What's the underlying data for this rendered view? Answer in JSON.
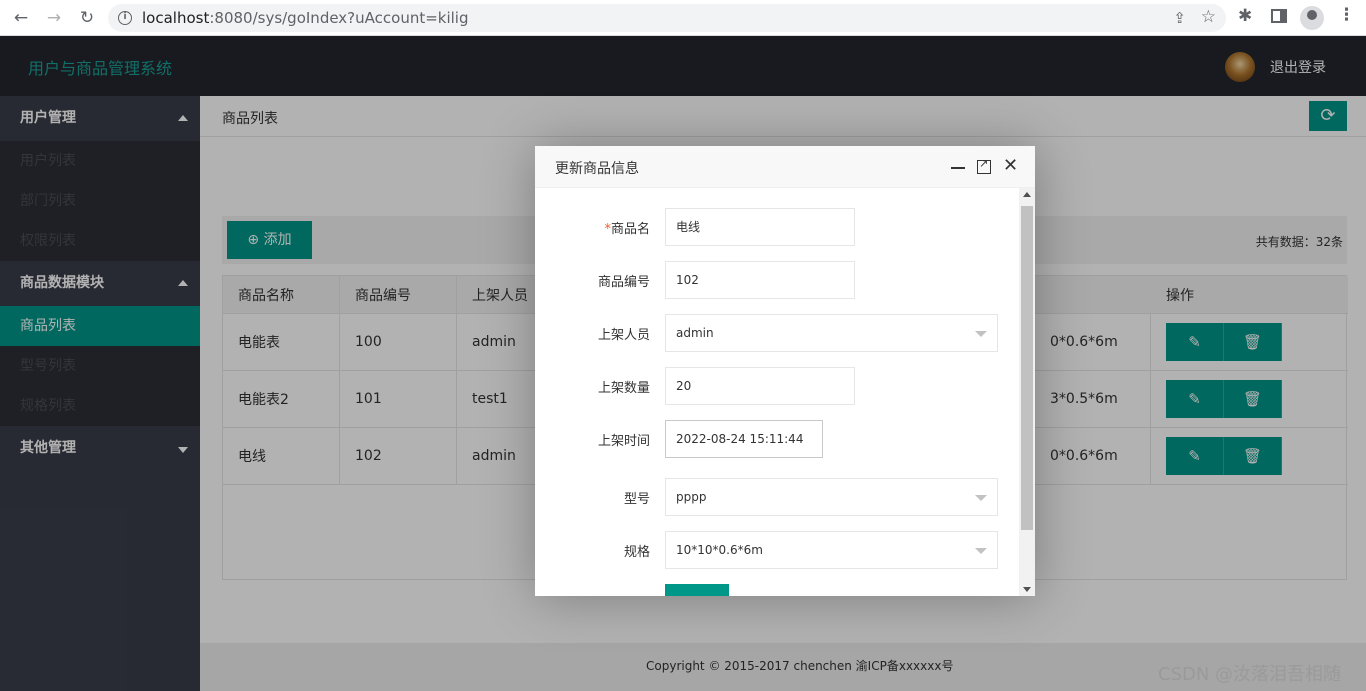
{
  "browser": {
    "url_host": "localhost",
    "url_rest": ":8080/sys/goIndex?uAccount=kilig"
  },
  "header": {
    "app_title": "用户与商品管理系统",
    "logout_label": "退出登录"
  },
  "sidebar": {
    "groups": [
      {
        "label": "用户管理",
        "items": [
          "用户列表",
          "部门列表",
          "权限列表"
        ]
      },
      {
        "label": "商品数据模块",
        "items": [
          "商品列表",
          "型号列表",
          "规格列表"
        ]
      },
      {
        "label": "其他管理",
        "items": []
      }
    ],
    "active_item": "商品列表"
  },
  "main": {
    "breadcrumb": "商品列表",
    "add_label": "添加",
    "total_label": "共有数据：32条",
    "table": {
      "columns": [
        "商品名称",
        "商品编号",
        "上架人员",
        "操作"
      ],
      "rows": [
        {
          "name": "电能表",
          "code": "100",
          "staff": "admin",
          "spec_tail": "0*0.6*6m"
        },
        {
          "name": "电能表2",
          "code": "101",
          "staff": "test1",
          "spec_tail": "3*0.5*6m"
        },
        {
          "name": "电线",
          "code": "102",
          "staff": "admin",
          "spec_tail": "0*0.6*6m"
        }
      ]
    }
  },
  "modal": {
    "title": "更新商品信息",
    "fields": {
      "name_label": "商品名",
      "name_value": "电线",
      "code_label": "商品编号",
      "code_value": "102",
      "staff_label": "上架人员",
      "staff_value": "admin",
      "qty_label": "上架数量",
      "qty_value": "20",
      "time_label": "上架时间",
      "time_value": "2022-08-24 15:11:44",
      "model_label": "型号",
      "model_value": "pppp",
      "spec_label": "规格",
      "spec_value": "10*10*0.6*6m"
    }
  },
  "footer": {
    "copyright": "Copyright © 2015-2017 chenchen 渝ICP备xxxxxx号",
    "watermark": "CSDN @汝落泪吾相随"
  },
  "colors": {
    "accent": "#009688",
    "header_bg": "#23262e",
    "sidebar_bg": "#393d49"
  }
}
